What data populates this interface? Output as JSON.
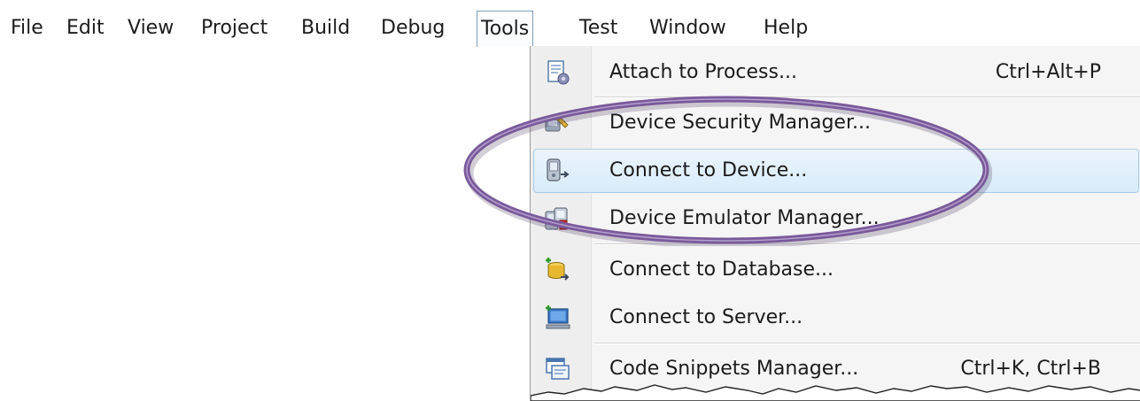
{
  "menubar": {
    "items": [
      {
        "label": "File"
      },
      {
        "label": "Edit"
      },
      {
        "label": "View"
      },
      {
        "label": "Project"
      },
      {
        "label": "Build"
      },
      {
        "label": "Debug"
      },
      {
        "label": "Tools",
        "active": true
      },
      {
        "label": "Test"
      },
      {
        "label": "Window"
      },
      {
        "label": "Help"
      }
    ]
  },
  "tools_menu": {
    "items": [
      {
        "label": "Attach to Process...",
        "shortcut": "Ctrl+Alt+P",
        "icon": "attach-process-icon"
      },
      {
        "label": "Device Security Manager...",
        "shortcut": "",
        "icon": "device-security-icon"
      },
      {
        "label": "Connect to Device...",
        "shortcut": "",
        "icon": "connect-device-icon",
        "highlighted": true
      },
      {
        "label": "Device Emulator Manager...",
        "shortcut": "",
        "icon": "device-emulator-icon"
      },
      {
        "label": "Connect to Database...",
        "shortcut": "",
        "icon": "connect-database-icon"
      },
      {
        "label": "Connect to Server...",
        "shortcut": "",
        "icon": "connect-server-icon"
      },
      {
        "label": "Code Snippets Manager...",
        "shortcut": "Ctrl+K, Ctrl+B",
        "icon": "code-snippets-icon"
      }
    ]
  },
  "colors": {
    "highlight_fill": "#d9ebfa",
    "highlight_border": "#a8cbe8",
    "callout_ring": "#7a5a9a",
    "menu_background": "#f5f5f5"
  }
}
